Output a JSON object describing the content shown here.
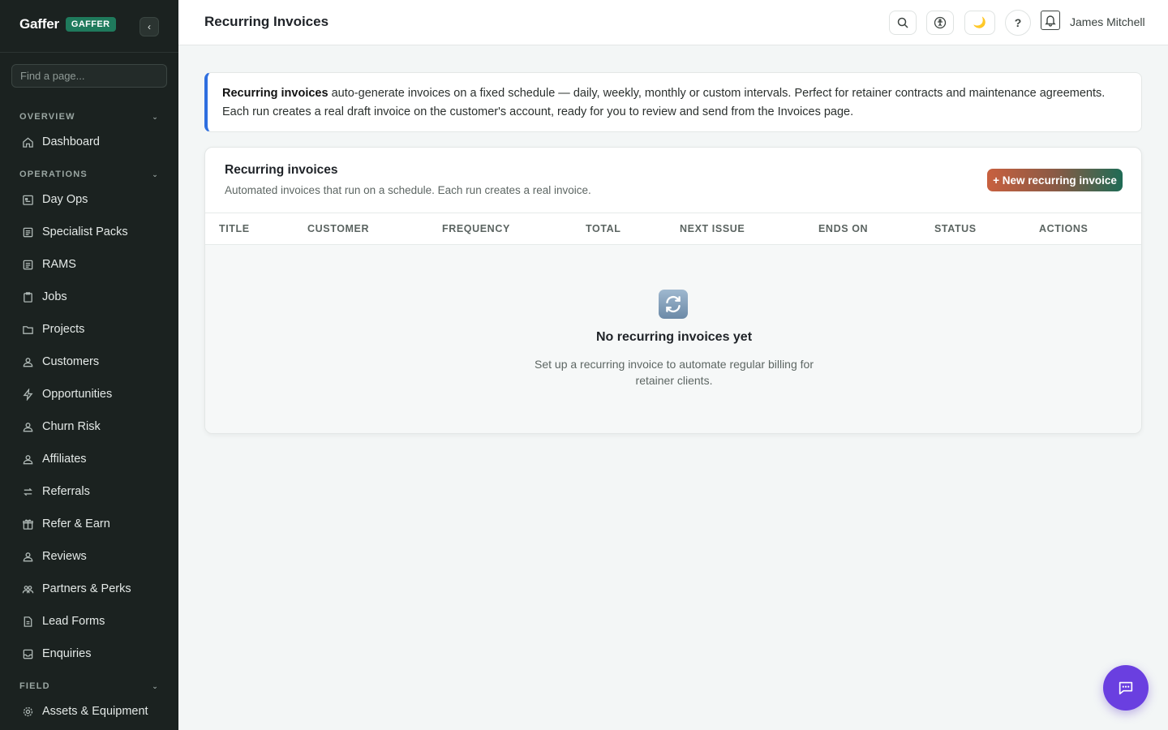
{
  "brand": {
    "name": "Gaffer",
    "badge": "GAFFER",
    "collapse_glyph": "‹"
  },
  "search": {
    "placeholder": "Find a page..."
  },
  "sidebar": {
    "sections": [
      {
        "label": "OVERVIEW"
      },
      {
        "label": "OPERATIONS"
      },
      {
        "label": "FIELD"
      }
    ],
    "items": [
      {
        "label": "Dashboard",
        "icon": "home-icon"
      },
      {
        "label": "Day Ops",
        "icon": "calendar-icon"
      },
      {
        "label": "Specialist Packs",
        "icon": "doc-list-icon"
      },
      {
        "label": "RAMS",
        "icon": "doc-list-icon"
      },
      {
        "label": "Jobs",
        "icon": "clipboard-icon"
      },
      {
        "label": "Projects",
        "icon": "folder-icon"
      },
      {
        "label": "Customers",
        "icon": "person-icon"
      },
      {
        "label": "Opportunities",
        "icon": "bolt-icon"
      },
      {
        "label": "Churn Risk",
        "icon": "person-icon"
      },
      {
        "label": "Affiliates",
        "icon": "person-icon"
      },
      {
        "label": "Referrals",
        "icon": "arrows-icon"
      },
      {
        "label": "Refer & Earn",
        "icon": "gift-icon"
      },
      {
        "label": "Reviews",
        "icon": "person-icon"
      },
      {
        "label": "Partners & Perks",
        "icon": "people-icon"
      },
      {
        "label": "Lead Forms",
        "icon": "form-icon"
      },
      {
        "label": "Enquiries",
        "icon": "inbox-icon"
      },
      {
        "label": "Assets & Equipment",
        "icon": "gear-icon"
      }
    ]
  },
  "header": {
    "title": "Recurring Invoices",
    "help_glyph": "?",
    "theme_glyph": "🌙",
    "user_name": "James Mitchell"
  },
  "banner": {
    "bold": "Recurring invoices",
    "text": " auto-generate invoices on a fixed schedule — daily, weekly, monthly or custom intervals. Perfect for retainer contracts and maintenance agreements. Each run creates a real draft invoice on the customer's account, ready for you to review and send from the Invoices page."
  },
  "card": {
    "title": "Recurring invoices",
    "subtitle": "Automated invoices that run on a schedule. Each run creates a real invoice.",
    "new_button": "+ New recurring invoice",
    "columns": [
      "TITLE",
      "CUSTOMER",
      "FREQUENCY",
      "TOTAL",
      "NEXT ISSUE",
      "ENDS ON",
      "STATUS",
      "ACTIONS"
    ],
    "empty_title": "No recurring invoices yet",
    "empty_desc": "Set up a recurring invoice to automate regular billing for retainer clients."
  },
  "colors": {
    "sidebar_bg": "#1b2220",
    "brand_badge": "#1f7a5c",
    "banner_accent": "#2f6fdf",
    "chat_button": "#6a3fe0"
  }
}
